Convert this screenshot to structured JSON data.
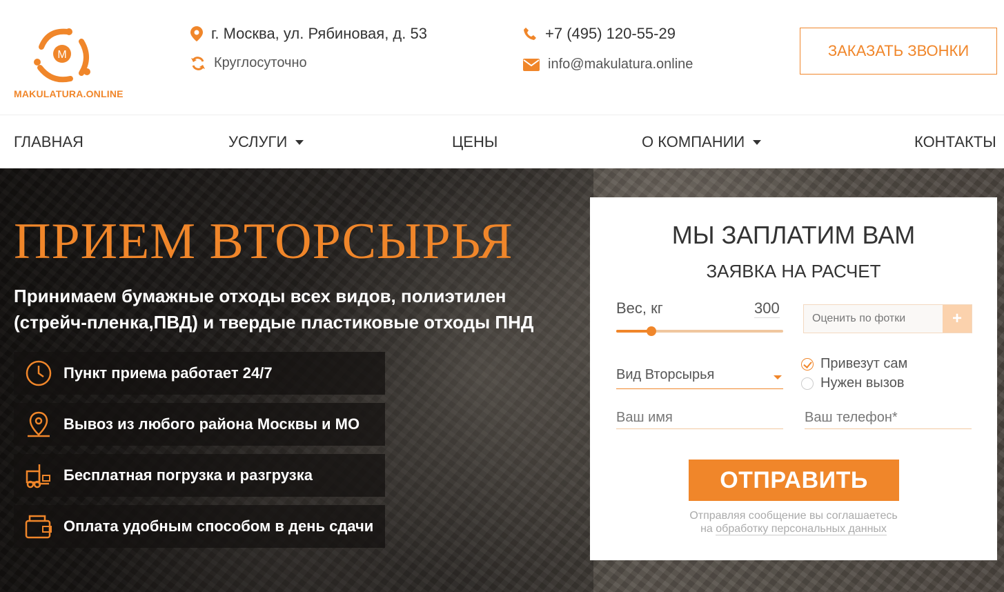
{
  "header": {
    "logo_text": "MAKULATURA.ONLINE",
    "address": "г. Москва, ул. Рябиновая, д. 53",
    "hours": "Круглосуточно",
    "phone": "+7 (495) 120-55-29",
    "email": "info@makulatura.online",
    "call_button": "ЗАКАЗАТЬ ЗВОНКИ"
  },
  "nav": {
    "items": [
      {
        "label": "ГЛАВНАЯ"
      },
      {
        "label": "УСЛУГИ"
      },
      {
        "label": "ЦЕНЫ"
      },
      {
        "label": "О КОМПАНИИ"
      },
      {
        "label": "КОНТАКТЫ"
      }
    ]
  },
  "hero": {
    "title": "ПРИЕМ ВТОРСЫРЬЯ",
    "subtitle": "Принимаем бумажные отходы всех видов, полиэтилен (стрейч-пленка,ПВД) и твердые пластиковые отходы ПНД",
    "features": [
      {
        "text": "Пункт приема работает 24/7",
        "icon": "clock-icon"
      },
      {
        "text": "Вывоз из любого района Москвы и МО",
        "icon": "map-pin-icon"
      },
      {
        "text": "Бесплатная погрузка и разгрузка",
        "icon": "forklift-icon"
      },
      {
        "text": "Оплата удобным способом в день сдачи",
        "icon": "wallet-icon"
      }
    ]
  },
  "form": {
    "title": "МЫ ЗАПЛАТИМ ВАМ",
    "subtitle": "ЗАЯВКА НА РАСЧЕТ",
    "weight_label": "Вес, кг",
    "weight_value": "300",
    "slider_fraction": 0.21,
    "photo_placeholder": "Оценить по фотки",
    "photo_plus": "+",
    "material_select": "Вид Вторсырья",
    "radio_options": [
      {
        "label": "Привезут сам",
        "checked": true
      },
      {
        "label": "Нужен вызов",
        "checked": false
      }
    ],
    "name_placeholder": "Ваш имя",
    "phone_placeholder": "Ваш телефон*",
    "submit": "ОТПРАВИТЬ",
    "note_prefix": "Отправляя сообщение вы соглашаетесь",
    "note_on": "на",
    "note_link": "обработку персональных данных"
  },
  "colors": {
    "accent": "#f0862a",
    "text": "#333333"
  }
}
